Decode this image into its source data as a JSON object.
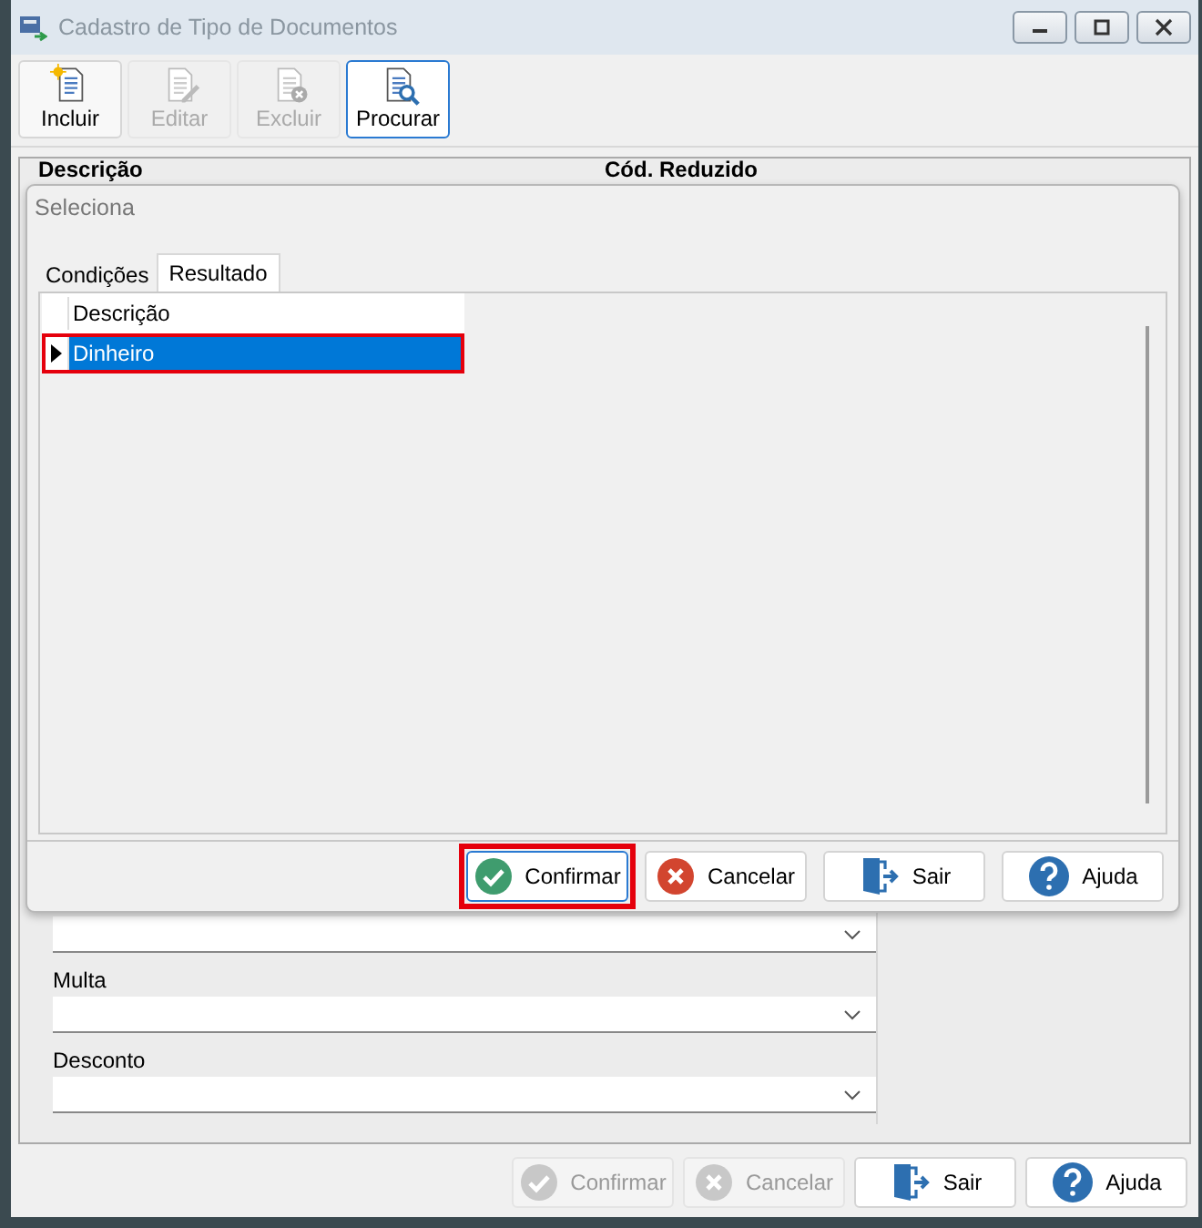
{
  "window": {
    "title": "Cadastro de Tipo de Documentos"
  },
  "toolbar": [
    {
      "label": "Incluir",
      "kind": "new",
      "disabled": false,
      "selected": false
    },
    {
      "label": "Editar",
      "kind": "edit",
      "disabled": true,
      "selected": false
    },
    {
      "label": "Excluir",
      "kind": "delete",
      "disabled": true,
      "selected": false
    },
    {
      "label": "Procurar",
      "kind": "search",
      "disabled": false,
      "selected": true
    }
  ],
  "form": {
    "columns": [
      "Descrição",
      "Cód. Reduzido"
    ],
    "fields": [
      {
        "kind": "combo"
      },
      {
        "kind": "combo",
        "label": "Multa"
      },
      {
        "kind": "combo",
        "label": "Desconto"
      }
    ]
  },
  "footer_buttons": [
    {
      "label": "Confirmar",
      "kind": "confirm",
      "disabled": true
    },
    {
      "label": "Cancelar",
      "kind": "cancel",
      "disabled": true
    },
    {
      "label": "Sair",
      "kind": "exit",
      "disabled": false
    },
    {
      "label": "Ajuda",
      "kind": "help",
      "disabled": false
    }
  ],
  "dialog": {
    "title": "Seleciona",
    "tabs": [
      {
        "label": "Condições",
        "selected": false
      },
      {
        "label": "Resultado",
        "selected": true
      }
    ],
    "grid": {
      "columns": [
        "Descrição"
      ],
      "rows": [
        {
          "cells": [
            "Dinheiro"
          ],
          "selected": true,
          "highlighted": true
        }
      ]
    },
    "buttons": [
      {
        "label": "Confirmar",
        "kind": "confirm",
        "focused": true,
        "highlighted": true
      },
      {
        "label": "Cancelar",
        "kind": "cancel",
        "focused": false,
        "highlighted": false
      },
      {
        "label": "Sair",
        "kind": "exit",
        "focused": false,
        "highlighted": false
      },
      {
        "label": "Ajuda",
        "kind": "help",
        "focused": false,
        "highlighted": false
      }
    ]
  }
}
